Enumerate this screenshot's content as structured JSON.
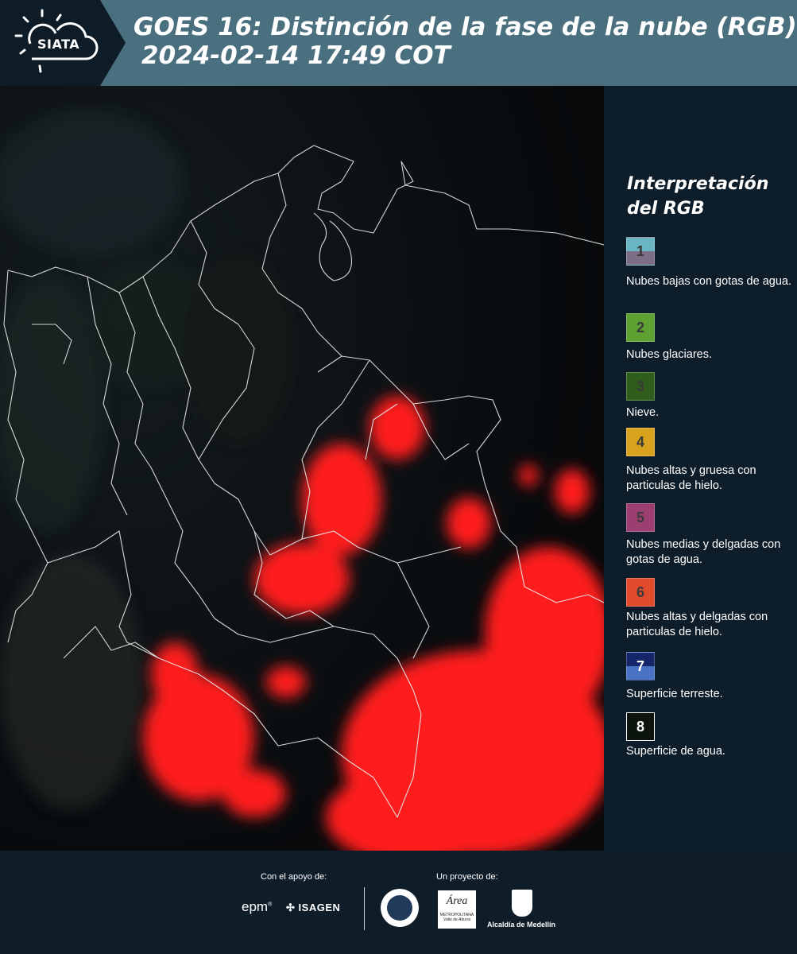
{
  "header": {
    "logo_text": "SIATA",
    "title_line1": "GOES 16: Distinción de la fase de la nube (RGB)",
    "title_line2": "2024-02-14 17:49 COT"
  },
  "legend": {
    "title": "Interpretación del RGB",
    "items": [
      {
        "number": "1",
        "desc": "Nubes bajas con gotas de agua.",
        "color_top": "#6ab7c3",
        "color_bottom": "#7b6e86"
      },
      {
        "number": "2",
        "desc": "Nubes glaciares.",
        "color_top": "#5fa234",
        "color_bottom": "#5fa234"
      },
      {
        "number": "3",
        "desc": "Nieve.",
        "color_top": "#2f5e1c",
        "color_bottom": "#2f5e1c"
      },
      {
        "number": "4",
        "desc": "Nubes altas y gruesa con particulas de hielo.",
        "color_top": "#d8a21c",
        "color_bottom": "#d8a21c"
      },
      {
        "number": "5",
        "desc": "Nubes medias y delgadas con gotas de agua.",
        "color_top": "#9c3f70",
        "color_bottom": "#9c3f70"
      },
      {
        "number": "6",
        "desc": "Nubes altas y delgadas con particulas de hielo.",
        "color_top": "#e24a2c",
        "color_bottom": "#e24a2c"
      },
      {
        "number": "7",
        "desc": "Superficie terreste.",
        "color_top": "#15266a",
        "color_bottom": "#4a72c4"
      },
      {
        "number": "8",
        "desc": "Superficie de agua.",
        "color_top": "#0b150e",
        "color_bottom": "#0b150e"
      }
    ]
  },
  "footer": {
    "support_label": "Con el apoyo de:",
    "project_label": "Un proyecto de:",
    "epm": "epm",
    "isagen": "ISAGEN",
    "area_line1": "Área",
    "area_line2": "METROPOLITANA",
    "area_line3": "Valle de Aburrá",
    "medellin": "Alcaldía de Medellín"
  }
}
